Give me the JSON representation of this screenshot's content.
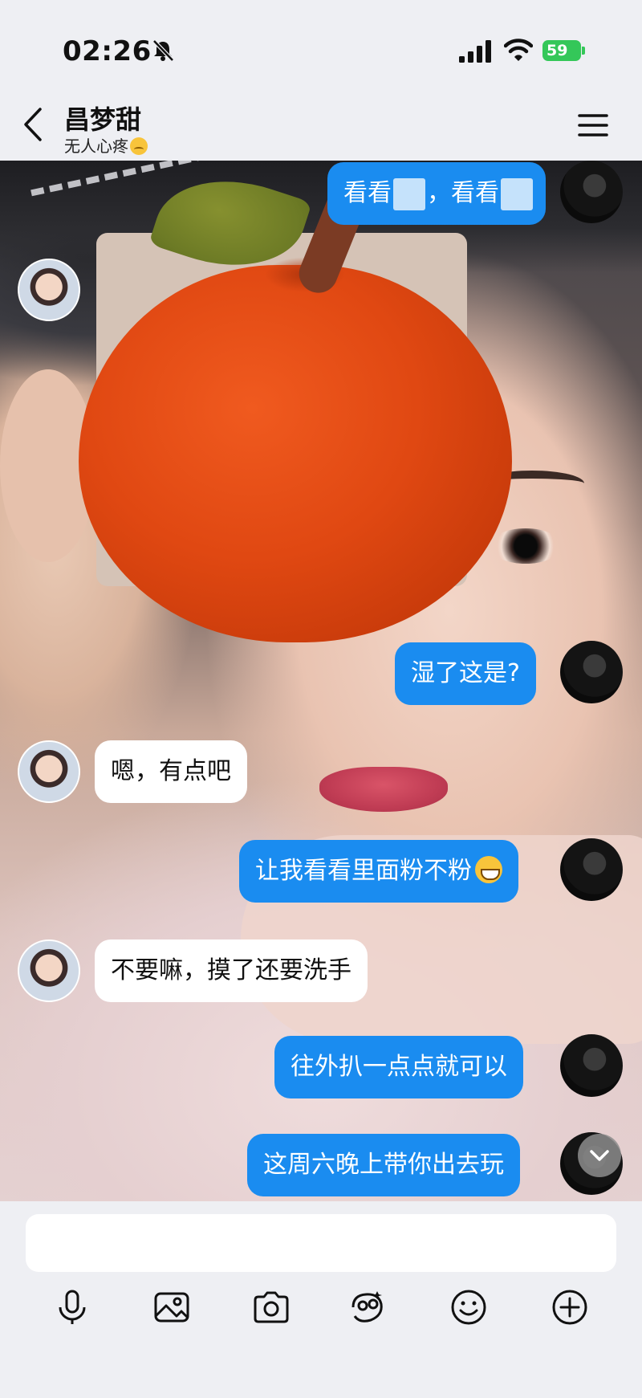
{
  "status_bar": {
    "time": "02:26",
    "battery": "59"
  },
  "header": {
    "contact_name": "昌梦甜",
    "contact_status": "无人心疼"
  },
  "messages": [
    {
      "side": "out",
      "text_a": "看看",
      "text_b": "，看看"
    },
    {
      "side": "out",
      "text": "湿了这是?"
    },
    {
      "side": "in",
      "text": "嗯，有点吧"
    },
    {
      "side": "out",
      "text": "让我看看里面粉不粉"
    },
    {
      "side": "in",
      "text": "不要嘛，摸了还要洗手"
    },
    {
      "side": "out",
      "text": "往外扒一点点就可以"
    },
    {
      "side": "out",
      "text": "这周六晚上带你出去玩"
    }
  ],
  "input": {
    "placeholder": ""
  },
  "toolbar_icons": [
    "microphone-icon",
    "image-icon",
    "camera-icon",
    "sticker-icon",
    "emoji-icon",
    "plus-icon"
  ],
  "colors": {
    "outgoing_bubble": "#1a8cf0",
    "incoming_bubble": "#ffffff",
    "battery": "#34c759"
  }
}
